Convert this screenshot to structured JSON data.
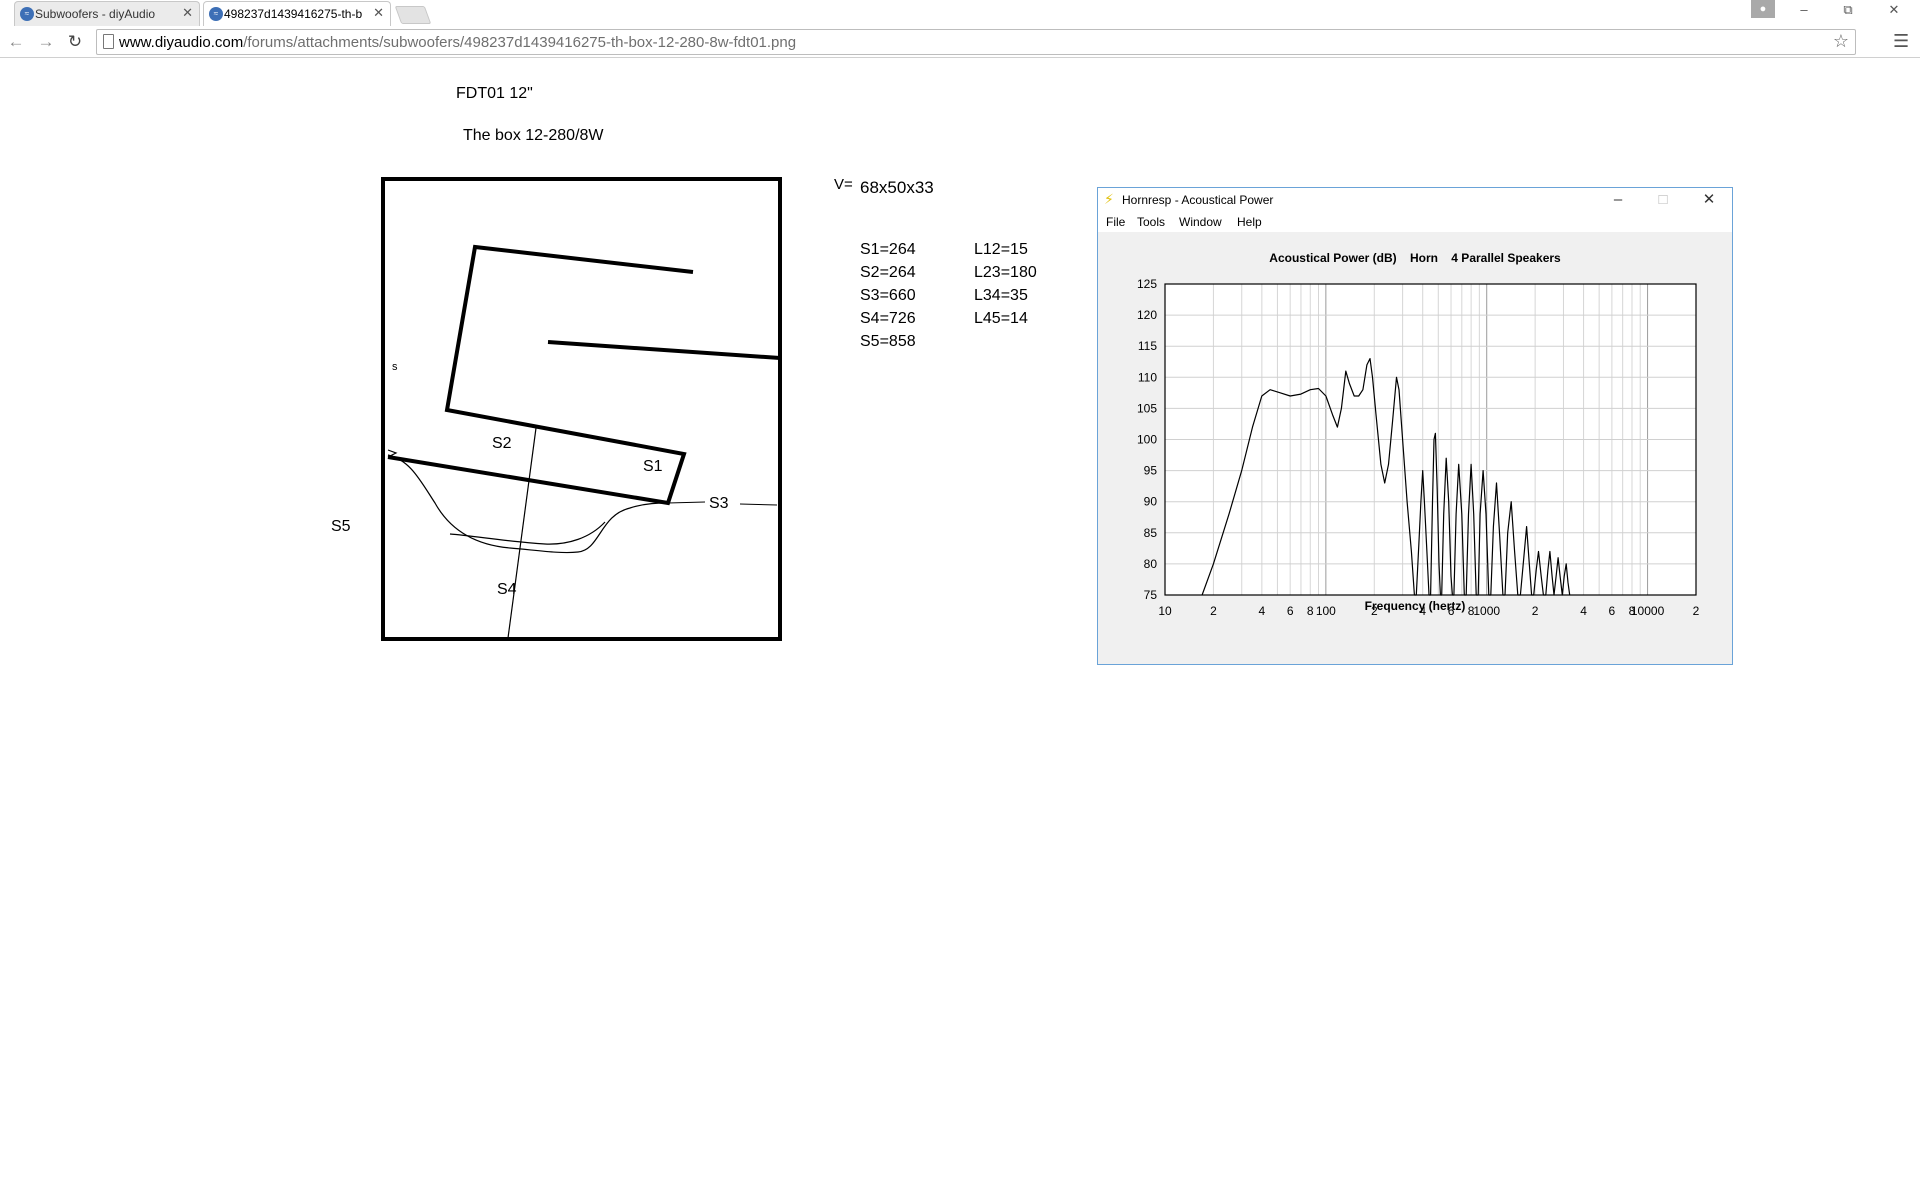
{
  "browser": {
    "tabs": [
      {
        "label": "Subwoofers - diyAudio",
        "active": false
      },
      {
        "label": "498237d1439416275-th-b",
        "active": true
      }
    ],
    "url_host": "www.diyaudio.com",
    "url_path": "/forums/attachments/subwoofers/498237d1439416275-th-box-12-280-8w-fdt01.png",
    "icons": {
      "back": "back-arrow-icon",
      "forward": "forward-arrow-icon",
      "reload": "reload-icon",
      "star": "star-icon",
      "menu": "menu-icon"
    }
  },
  "image": {
    "title1": "FDT01 12\"",
    "title2": "The box 12-280/8W",
    "v_label": "V=",
    "v_value": "68x50x33",
    "s_values": [
      "S1=264",
      "S2=264",
      "S3=660",
      "S4=726",
      "S5=858"
    ],
    "l_values": [
      "L12=15",
      "L23=180",
      "L34=35",
      "L45=14"
    ],
    "diagram_labels": {
      "s1": "S1",
      "s2": "S2",
      "s3": "S3",
      "s4": "S4",
      "s5": "S5"
    }
  },
  "hornresp": {
    "window_title": "Hornresp - Acoustical Power",
    "menu": [
      "File",
      "Tools",
      "Window",
      "Help"
    ],
    "accent": "#6aa3d8"
  },
  "chart_data": {
    "type": "line",
    "title": "Acoustical Power (dB)    Horn    4 Parallel Speakers",
    "xlabel": "Frequency (hertz)",
    "ylabel": "",
    "x_scale": "log",
    "xlim": [
      10,
      20000
    ],
    "ylim": [
      75,
      125
    ],
    "x_tick_labels": [
      {
        "v": 10,
        "t": "10"
      },
      {
        "v": 20,
        "t": "2"
      },
      {
        "v": 40,
        "t": "4"
      },
      {
        "v": 60,
        "t": "6"
      },
      {
        "v": 80,
        "t": "8"
      },
      {
        "v": 100,
        "t": "100"
      },
      {
        "v": 200,
        "t": "2"
      },
      {
        "v": 400,
        "t": "4"
      },
      {
        "v": 600,
        "t": "6"
      },
      {
        "v": 800,
        "t": "8"
      },
      {
        "v": 1000,
        "t": "1000"
      },
      {
        "v": 2000,
        "t": "2"
      },
      {
        "v": 4000,
        "t": "4"
      },
      {
        "v": 6000,
        "t": "6"
      },
      {
        "v": 8000,
        "t": "8"
      },
      {
        "v": 10000,
        "t": "10000"
      },
      {
        "v": 20000,
        "t": "2"
      }
    ],
    "y_ticks": [
      75,
      80,
      85,
      90,
      95,
      100,
      105,
      110,
      115,
      120,
      125
    ],
    "grid": true,
    "series": [
      {
        "points": [
          [
            17,
            75
          ],
          [
            20,
            80
          ],
          [
            25,
            88
          ],
          [
            30,
            95
          ],
          [
            35,
            102
          ],
          [
            40,
            107
          ],
          [
            45,
            108
          ],
          [
            52,
            107.5
          ],
          [
            60,
            107
          ],
          [
            70,
            107.3
          ],
          [
            80,
            108
          ],
          [
            90,
            108.2
          ],
          [
            100,
            107
          ],
          [
            110,
            104
          ],
          [
            118,
            102
          ],
          [
            125,
            105
          ],
          [
            133,
            111
          ],
          [
            140,
            109
          ],
          [
            150,
            107
          ],
          [
            160,
            107
          ],
          [
            170,
            108
          ],
          [
            180,
            112
          ],
          [
            188,
            113
          ],
          [
            195,
            110
          ],
          [
            205,
            104
          ],
          [
            220,
            96
          ],
          [
            232,
            93
          ],
          [
            245,
            96
          ],
          [
            260,
            103
          ],
          [
            275,
            110
          ],
          [
            285,
            108
          ],
          [
            300,
            100
          ],
          [
            320,
            90
          ],
          [
            340,
            82
          ],
          [
            355,
            75
          ],
          [
            365,
            75
          ],
          [
            378,
            83
          ],
          [
            390,
            90
          ],
          [
            400,
            95
          ],
          [
            410,
            90
          ],
          [
            425,
            82
          ],
          [
            438,
            75
          ],
          [
            448,
            75
          ],
          [
            460,
            90
          ],
          [
            470,
            100
          ],
          [
            480,
            101
          ],
          [
            492,
            92
          ],
          [
            505,
            80
          ],
          [
            515,
            75
          ],
          [
            525,
            75
          ],
          [
            540,
            88
          ],
          [
            560,
            97
          ],
          [
            580,
            90
          ],
          [
            600,
            78
          ],
          [
            612,
            75
          ],
          [
            625,
            75
          ],
          [
            645,
            88
          ],
          [
            670,
            96
          ],
          [
            700,
            88
          ],
          [
            725,
            75
          ],
          [
            745,
            75
          ],
          [
            770,
            88
          ],
          [
            800,
            96
          ],
          [
            830,
            88
          ],
          [
            860,
            75
          ],
          [
            885,
            75
          ],
          [
            910,
            88
          ],
          [
            950,
            95
          ],
          [
            990,
            88
          ],
          [
            1030,
            75
          ],
          [
            1060,
            75
          ],
          [
            1100,
            86
          ],
          [
            1150,
            93
          ],
          [
            1200,
            85
          ],
          [
            1260,
            75
          ],
          [
            1300,
            75
          ],
          [
            1350,
            85
          ],
          [
            1420,
            90
          ],
          [
            1490,
            82
          ],
          [
            1560,
            75
          ],
          [
            1620,
            75
          ],
          [
            1700,
            81
          ],
          [
            1770,
            86
          ],
          [
            1840,
            80
          ],
          [
            1900,
            75
          ],
          [
            1960,
            75
          ],
          [
            2030,
            79
          ],
          [
            2100,
            82
          ],
          [
            2180,
            78
          ],
          [
            2250,
            75
          ],
          [
            2330,
            75
          ],
          [
            2400,
            79
          ],
          [
            2470,
            82
          ],
          [
            2550,
            78
          ],
          [
            2620,
            75
          ],
          [
            2700,
            78
          ],
          [
            2780,
            81
          ],
          [
            2860,
            78
          ],
          [
            2950,
            75
          ],
          [
            3030,
            78
          ],
          [
            3120,
            80
          ],
          [
            3200,
            77
          ],
          [
            3280,
            75
          ]
        ]
      }
    ]
  }
}
